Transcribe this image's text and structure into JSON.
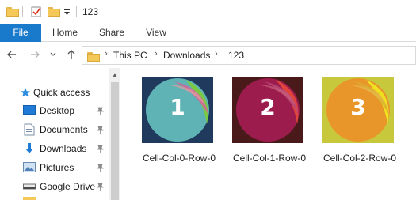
{
  "window": {
    "title": "123"
  },
  "ribbon": {
    "tabs": [
      "File",
      "Home",
      "Share",
      "View"
    ]
  },
  "address": {
    "breadcrumbs": [
      "This PC",
      "Downloads",
      "123"
    ]
  },
  "nav_pane": {
    "items": [
      {
        "label": "Quick access",
        "icon": "star-icon",
        "pinned": false
      },
      {
        "label": "Desktop",
        "icon": "desktop-icon",
        "pinned": true
      },
      {
        "label": "Documents",
        "icon": "documents-icon",
        "pinned": true
      },
      {
        "label": "Downloads",
        "icon": "download-arrow-icon",
        "pinned": true
      },
      {
        "label": "Pictures",
        "icon": "pictures-icon",
        "pinned": true
      },
      {
        "label": "Google Drive",
        "icon": "drive-icon",
        "pinned": true
      }
    ]
  },
  "files": [
    {
      "name": "Cell-Col-0-Row-0",
      "number": "1",
      "bg": "#1f3a5c",
      "circle": "#5fb3b5",
      "accent": "#7ac943"
    },
    {
      "name": "Cell-Col-1-Row-0",
      "number": "2",
      "bg": "#4a1a1a",
      "circle": "#9c1c4e",
      "accent": "#e0443c"
    },
    {
      "name": "Cell-Col-2-Row-0",
      "number": "3",
      "bg": "#c8c83c",
      "circle": "#e8962a",
      "accent": "#f0e020"
    }
  ],
  "colors": {
    "file_tab": "#1979ca",
    "folder": "#f4c95a",
    "quick_access_star": "#2b8ce0"
  }
}
